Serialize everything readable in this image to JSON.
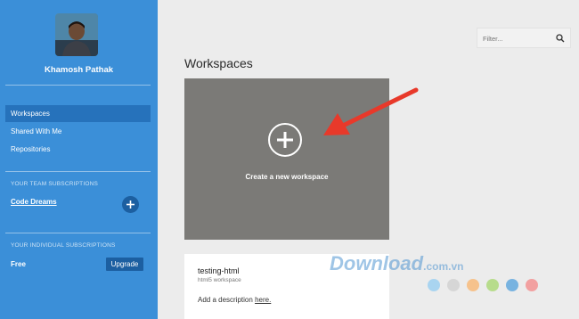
{
  "sidebar": {
    "username": "Khamosh Pathak",
    "nav": [
      {
        "label": "Workspaces",
        "active": true
      },
      {
        "label": "Shared With Me",
        "active": false
      },
      {
        "label": "Repositories",
        "active": false
      }
    ],
    "team_section_title": "YOUR TEAM SUBSCRIPTIONS",
    "team_link": "Code Dreams",
    "add_icon": "plus",
    "individual_section_title": "YOUR INDIVIDUAL SUBSCRIPTIONS",
    "plan": "Free",
    "upgrade_label": "Upgrade"
  },
  "filter": {
    "placeholder": "Filter...",
    "icon": "search-icon"
  },
  "main": {
    "title": "Workspaces",
    "create_label": "Create a new workspace",
    "workspace": {
      "name": "testing-html",
      "type": "html5 workspace",
      "desc_prefix": "Add a description",
      "desc_link": "here."
    }
  },
  "watermark": {
    "text": "Download",
    "suffix": ".com.vn"
  },
  "colors": {
    "sidebar": "#3b8fd8",
    "sidebar_active": "#2672bb",
    "tile": "#7b7a77",
    "arrow": "#e8392a",
    "dots": [
      "#a9d4f0",
      "#d6d6d6",
      "#f6c28c",
      "#b7dc8c",
      "#78b3e0",
      "#f2a0a0"
    ]
  }
}
